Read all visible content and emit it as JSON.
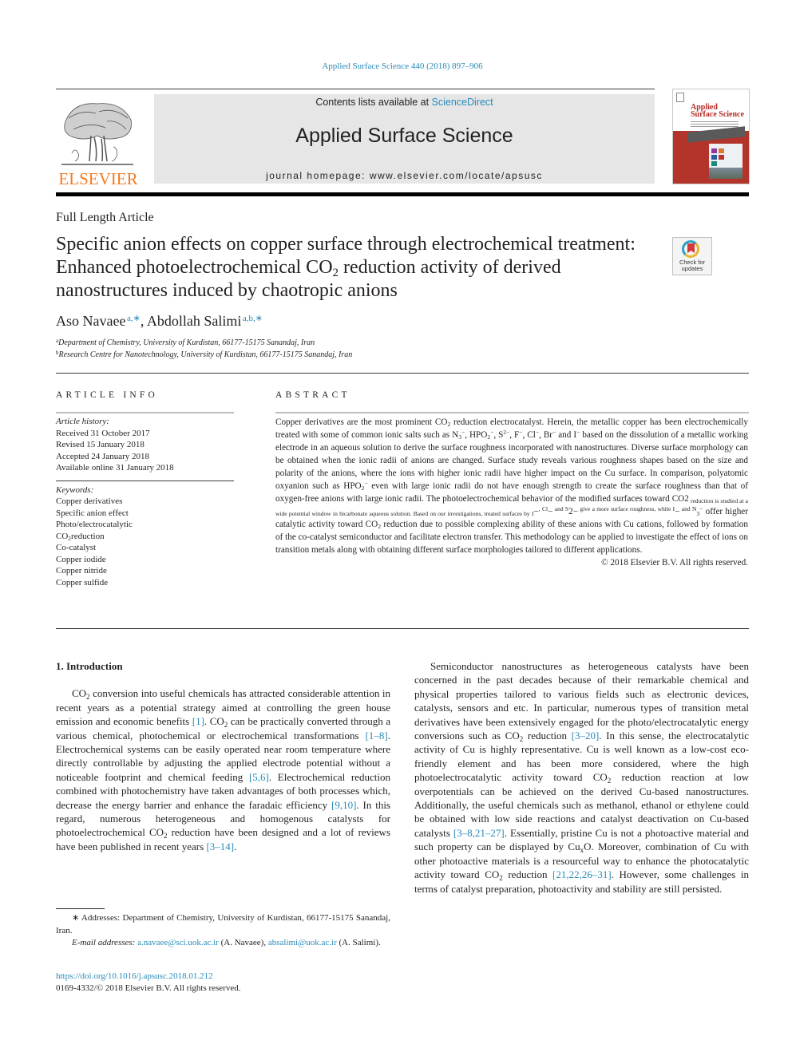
{
  "header": {
    "citation": "Applied Surface Science 440 (2018) 897–906",
    "contents_prefix": "Contents lists available at ",
    "contents_link": "ScienceDirect",
    "journal_title": "Applied Surface Science",
    "homepage_prefix": "journal homepage: ",
    "homepage_url": "www.elsevier.com/locate/apsusc",
    "publisher_logo_text": "ELSEVIER",
    "cover": {
      "title_line1": "Applied",
      "title_line2": "Surface Science"
    },
    "colors": {
      "link": "#2a8ab8",
      "elsevier_orange": "#f47b20",
      "cover_red": "#b2342a"
    }
  },
  "article": {
    "type": "Full Length Article",
    "title_part1": "Specific anion effects on copper surface through electrochemical treatment: Enhanced photoelectrochemical CO",
    "title_sub": "2",
    "title_part2": " reduction activity of derived nanostructures induced by chaotropic anions",
    "crossmark": {
      "line1": "Check for",
      "line2": "updates"
    },
    "authors": [
      {
        "name": "Aso Navaee",
        "marks": "a,∗"
      },
      {
        "name": "Abdollah Salimi",
        "marks": "a,b,∗"
      }
    ],
    "author_separator": ", ",
    "affiliations": [
      {
        "mark": "a",
        "text": "Department of Chemistry, University of Kurdistan, 66177-15175 Sanandaj, Iran"
      },
      {
        "mark": "b",
        "text": "Research Centre for Nanotechnology, University of Kurdistan, 66177-15175 Sanandaj, Iran"
      }
    ]
  },
  "article_info": {
    "heading": "ARTICLE INFO",
    "history_label": "Article history:",
    "history": [
      "Received 31 October 2017",
      "Revised 15 January 2018",
      "Accepted 24 January 2018",
      "Available online 31 January 2018"
    ],
    "keywords_label": "Keywords:",
    "keywords": [
      "Copper derivatives",
      "Specific anion effect",
      "Photo/electrocatalytic",
      "CO",
      "Co-catalyst",
      "Copper iodide",
      "Copper nitride",
      "Copper sulfide"
    ],
    "keyword_co2_sub": "2",
    "keyword_co2_rest": "reduction"
  },
  "abstract": {
    "heading": "ABSTRACT",
    "segments": [
      "Copper derivatives are the most prominent CO",
      "2",
      " reduction electrocatalyst. Herein, the metallic copper has been electrochemically treated with some of common ionic salts such as N",
      "3",
      "−",
      ", HPO",
      "2",
      "−",
      ", S",
      "2−",
      ", F",
      "−",
      ", Cl",
      "−",
      ", Br",
      "−",
      " and I",
      "−",
      " based on the dissolution of a metallic working electrode in an aqueous solution to derive the surface roughness incorporated with nanostructures. Diverse surface morphology can be obtained when the ionic radii of anions are changed. Surface study reveals various roughness shapes based on the size and polarity of the anions, where the ions with higher ionic radii have higher impact on the Cu surface. In comparison, polyatomic oxyanion such as HPO",
      "2",
      "−",
      " even with large ionic radii do not have enough strength to create the surface roughness than that of oxygen-free anions with large ionic radii. The photoelectrochemical behavior of the modified surfaces toward CO",
      "2",
      " reduction is studied at a wide potential window in bicarbonate aqueous solution. Based on our investigations, treated surfaces by I",
      "−",
      ", Cl",
      "−",
      " and S",
      "2−",
      " give a more surface roughness, while I",
      "−",
      " and N",
      "3",
      "−",
      " offer higher catalytic activity toward CO",
      "2",
      " reduction due to possible complexing ability of these anions with Cu cations, followed by formation of the co-catalyst semiconductor and facilitate electron transfer. This methodology can be applied to investigate the effect of ions on transition metals along with obtaining different surface morphologies tailored to different applications."
    ],
    "copyright": "© 2018 Elsevier B.V. All rights reserved."
  },
  "body": {
    "section_title": "1. Introduction",
    "left_paragraph": [
      {
        "t": "CO"
      },
      {
        "sub": "2"
      },
      {
        "t": " conversion into useful chemicals has attracted considerable attention in recent years as a potential strategy aimed at controlling the green house emission and economic benefits "
      },
      {
        "ref": "[1]"
      },
      {
        "t": ". CO"
      },
      {
        "sub": "2"
      },
      {
        "t": " can be practically converted through a various chemical, photochemical or electrochemical transformations "
      },
      {
        "ref": "[1–8]"
      },
      {
        "t": ". Electrochemical systems can be easily operated near room temperature where directly controllable by adjusting the applied electrode potential without a noticeable footprint and chemical feeding "
      },
      {
        "ref": "[5,6]"
      },
      {
        "t": ". Electrochemical reduction combined with photochemistry have taken advantages of both processes which, decrease the energy barrier and enhance the faradaic efficiency "
      },
      {
        "ref": "[9,10]"
      },
      {
        "t": ". In this regard, numerous heterogeneous and homogenous catalysts for photoelectrochemical CO"
      },
      {
        "sub": "2"
      },
      {
        "t": " reduction have been designed and a lot of reviews have been published in recent years "
      },
      {
        "ref": "[3–14]"
      },
      {
        "t": "."
      }
    ],
    "right_paragraph": [
      {
        "t": "Semiconductor nanostructures as heterogeneous catalysts have been concerned in the past decades because of their remarkable chemical and physical properties tailored to various fields such as electronic devices, catalysts, sensors and etc. In particular, numerous types of transition metal derivatives have been extensively engaged for the photo/electrocatalytic energy conversions such as CO"
      },
      {
        "sub": "2"
      },
      {
        "t": " reduction "
      },
      {
        "ref": "[3–20]"
      },
      {
        "t": ". In this sense, the electrocatalytic activity of Cu is highly representative. Cu is well known as a low-cost eco-friendly element and has been more considered, where the high photoelectrocatalytic activity toward CO"
      },
      {
        "sub": "2"
      },
      {
        "t": " reduction reaction at low overpotentials can be achieved on the derived Cu-based nanostructures. Additionally, the useful chemicals such as methanol, ethanol or ethylene could be obtained with low side reactions and catalyst deactivation on Cu-based catalysts "
      },
      {
        "ref": "[3–8,21–27]"
      },
      {
        "t": ". Essentially, pristine Cu is not a photoactive material and such property can be displayed by Cu"
      },
      {
        "sub": "x"
      },
      {
        "t": "O. Moreover, combination of Cu with other photoactive materials is a resourceful way to enhance the photocatalytic activity toward CO"
      },
      {
        "sub": "2"
      },
      {
        "t": " reduction "
      },
      {
        "ref": "[21,22,26–31]"
      },
      {
        "t": ". However, some challenges in terms of catalyst preparation, photoactivity and stability are still persisted."
      }
    ]
  },
  "footnotes": {
    "address_mark": "∗",
    "address_text": " Addresses: Department of Chemistry, University of Kurdistan, 66177-15175 Sanandaj, Iran.",
    "email_label": "E-mail addresses:",
    "email1": "a.navaee@sci.uok.ac.ir",
    "email1_owner": " (A. Navaee), ",
    "email2": "absalimi@uok.ac.ir",
    "email2_owner": " (A. Salimi).",
    "doi": "https://doi.org/10.1016/j.apsusc.2018.01.212",
    "issn_line": "0169-4332/© 2018 Elsevier B.V. All rights reserved."
  }
}
